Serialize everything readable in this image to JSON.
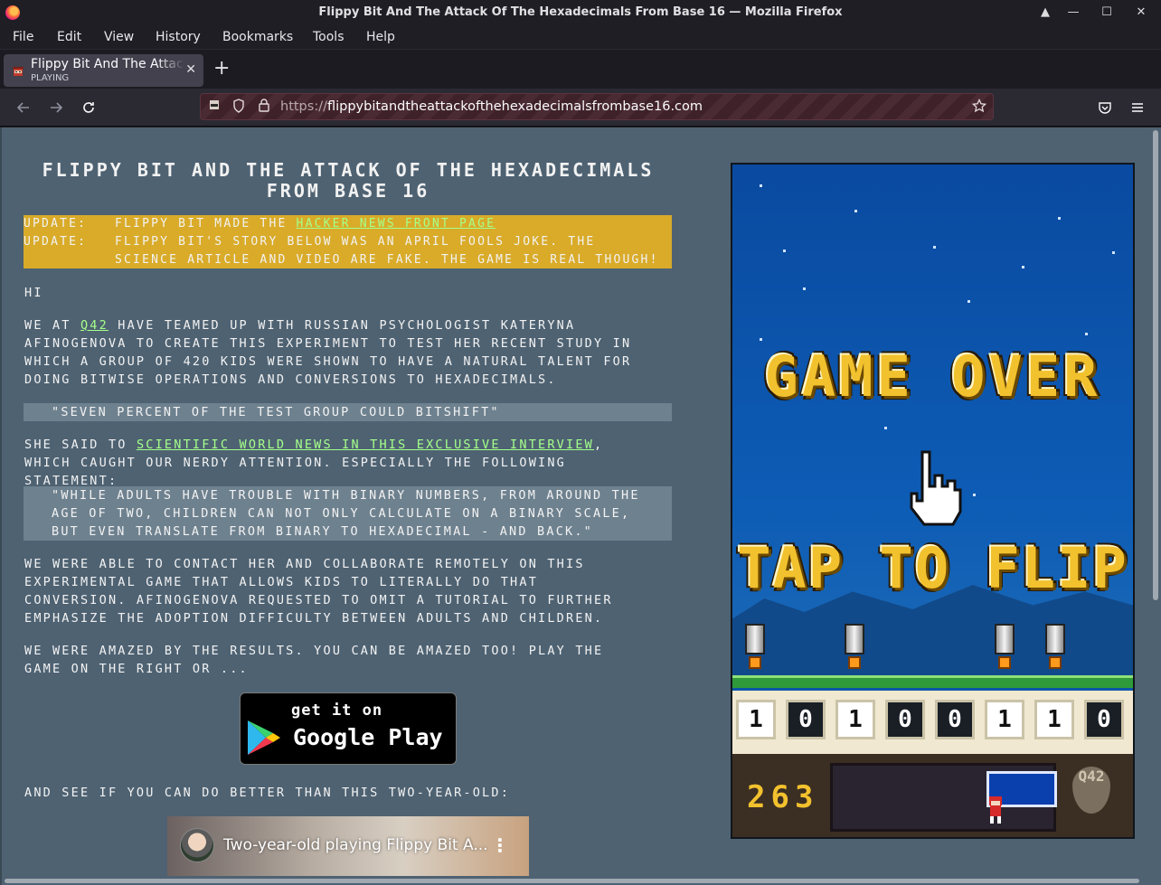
{
  "window": {
    "title": "Flippy Bit And The Attack Of The Hexadecimals From Base 16 — Mozilla Firefox",
    "controls": [
      "▲",
      "—",
      "☐",
      "✕"
    ]
  },
  "menu": [
    "File",
    "Edit",
    "View",
    "History",
    "Bookmarks",
    "Tools",
    "Help"
  ],
  "tab": {
    "title": "Flippy Bit And The Attack Of The Hexadecimals From Base 16",
    "status": "PLAYING",
    "close": "✕",
    "new_tab": "+"
  },
  "nav": {
    "url_protocol": "https://",
    "url_host": "flippybitandtheattackofthehexadecimalsfrombase16.com"
  },
  "page": {
    "headline": "Flippy Bit and the Attack of the Hexadecimals from Base 16",
    "updates": [
      {
        "label": "Update:",
        "text_before": "Flippy Bit made the ",
        "link": "Hacker News front page",
        "text_after": ""
      },
      {
        "label": "Update:",
        "text": "Flippy Bit's story below was an April Fools joke. The science article and video are fake. The game is real though!"
      }
    ],
    "greeting": "Hi",
    "intro_before": "We at ",
    "intro_link": "Q42",
    "intro_after": " have teamed up with Russian psychologist Kateryna Afinogenova to create this experiment to test her recent study in which a group of 420 kids were shown to have a natural talent for doing bitwise operations and conversions to hexadecimals.",
    "quote1": "\"Seven percent of the test group could bitshift\"",
    "said_before": "She said to ",
    "said_link": "Scientific World News in this exclusive interview",
    "said_after": ", which caught our nerdy attention. Especially the following statement:",
    "quote2": "\"While adults have trouble with binary numbers, from around the age of two, children can not only calculate on a binary scale, but even translate from binary to hexadecimal - and back.\"",
    "para_contact": "We were able to contact her and collaborate remotely on this experimental game that allows kids to literally do that conversion. Afinogenova requested to omit a tutorial to further emphasize the adoption difficulty between adults and children.",
    "para_amazed": "We were amazed by the results. You can be amazed too! Play the game on the right or ...",
    "gplay_small": "get it on",
    "gplay_big": "Google Play",
    "para_see": "And see if you can do better than this two-year-old:",
    "video_title": "Two-year-old playing Flippy Bit A..."
  },
  "game": {
    "game_over": "GAME OVER",
    "tap": "TAP TO FLIP",
    "bits": [
      "1",
      "0",
      "1",
      "0",
      "0",
      "1",
      "1",
      "0"
    ],
    "score": "263",
    "logo": "Q42"
  }
}
